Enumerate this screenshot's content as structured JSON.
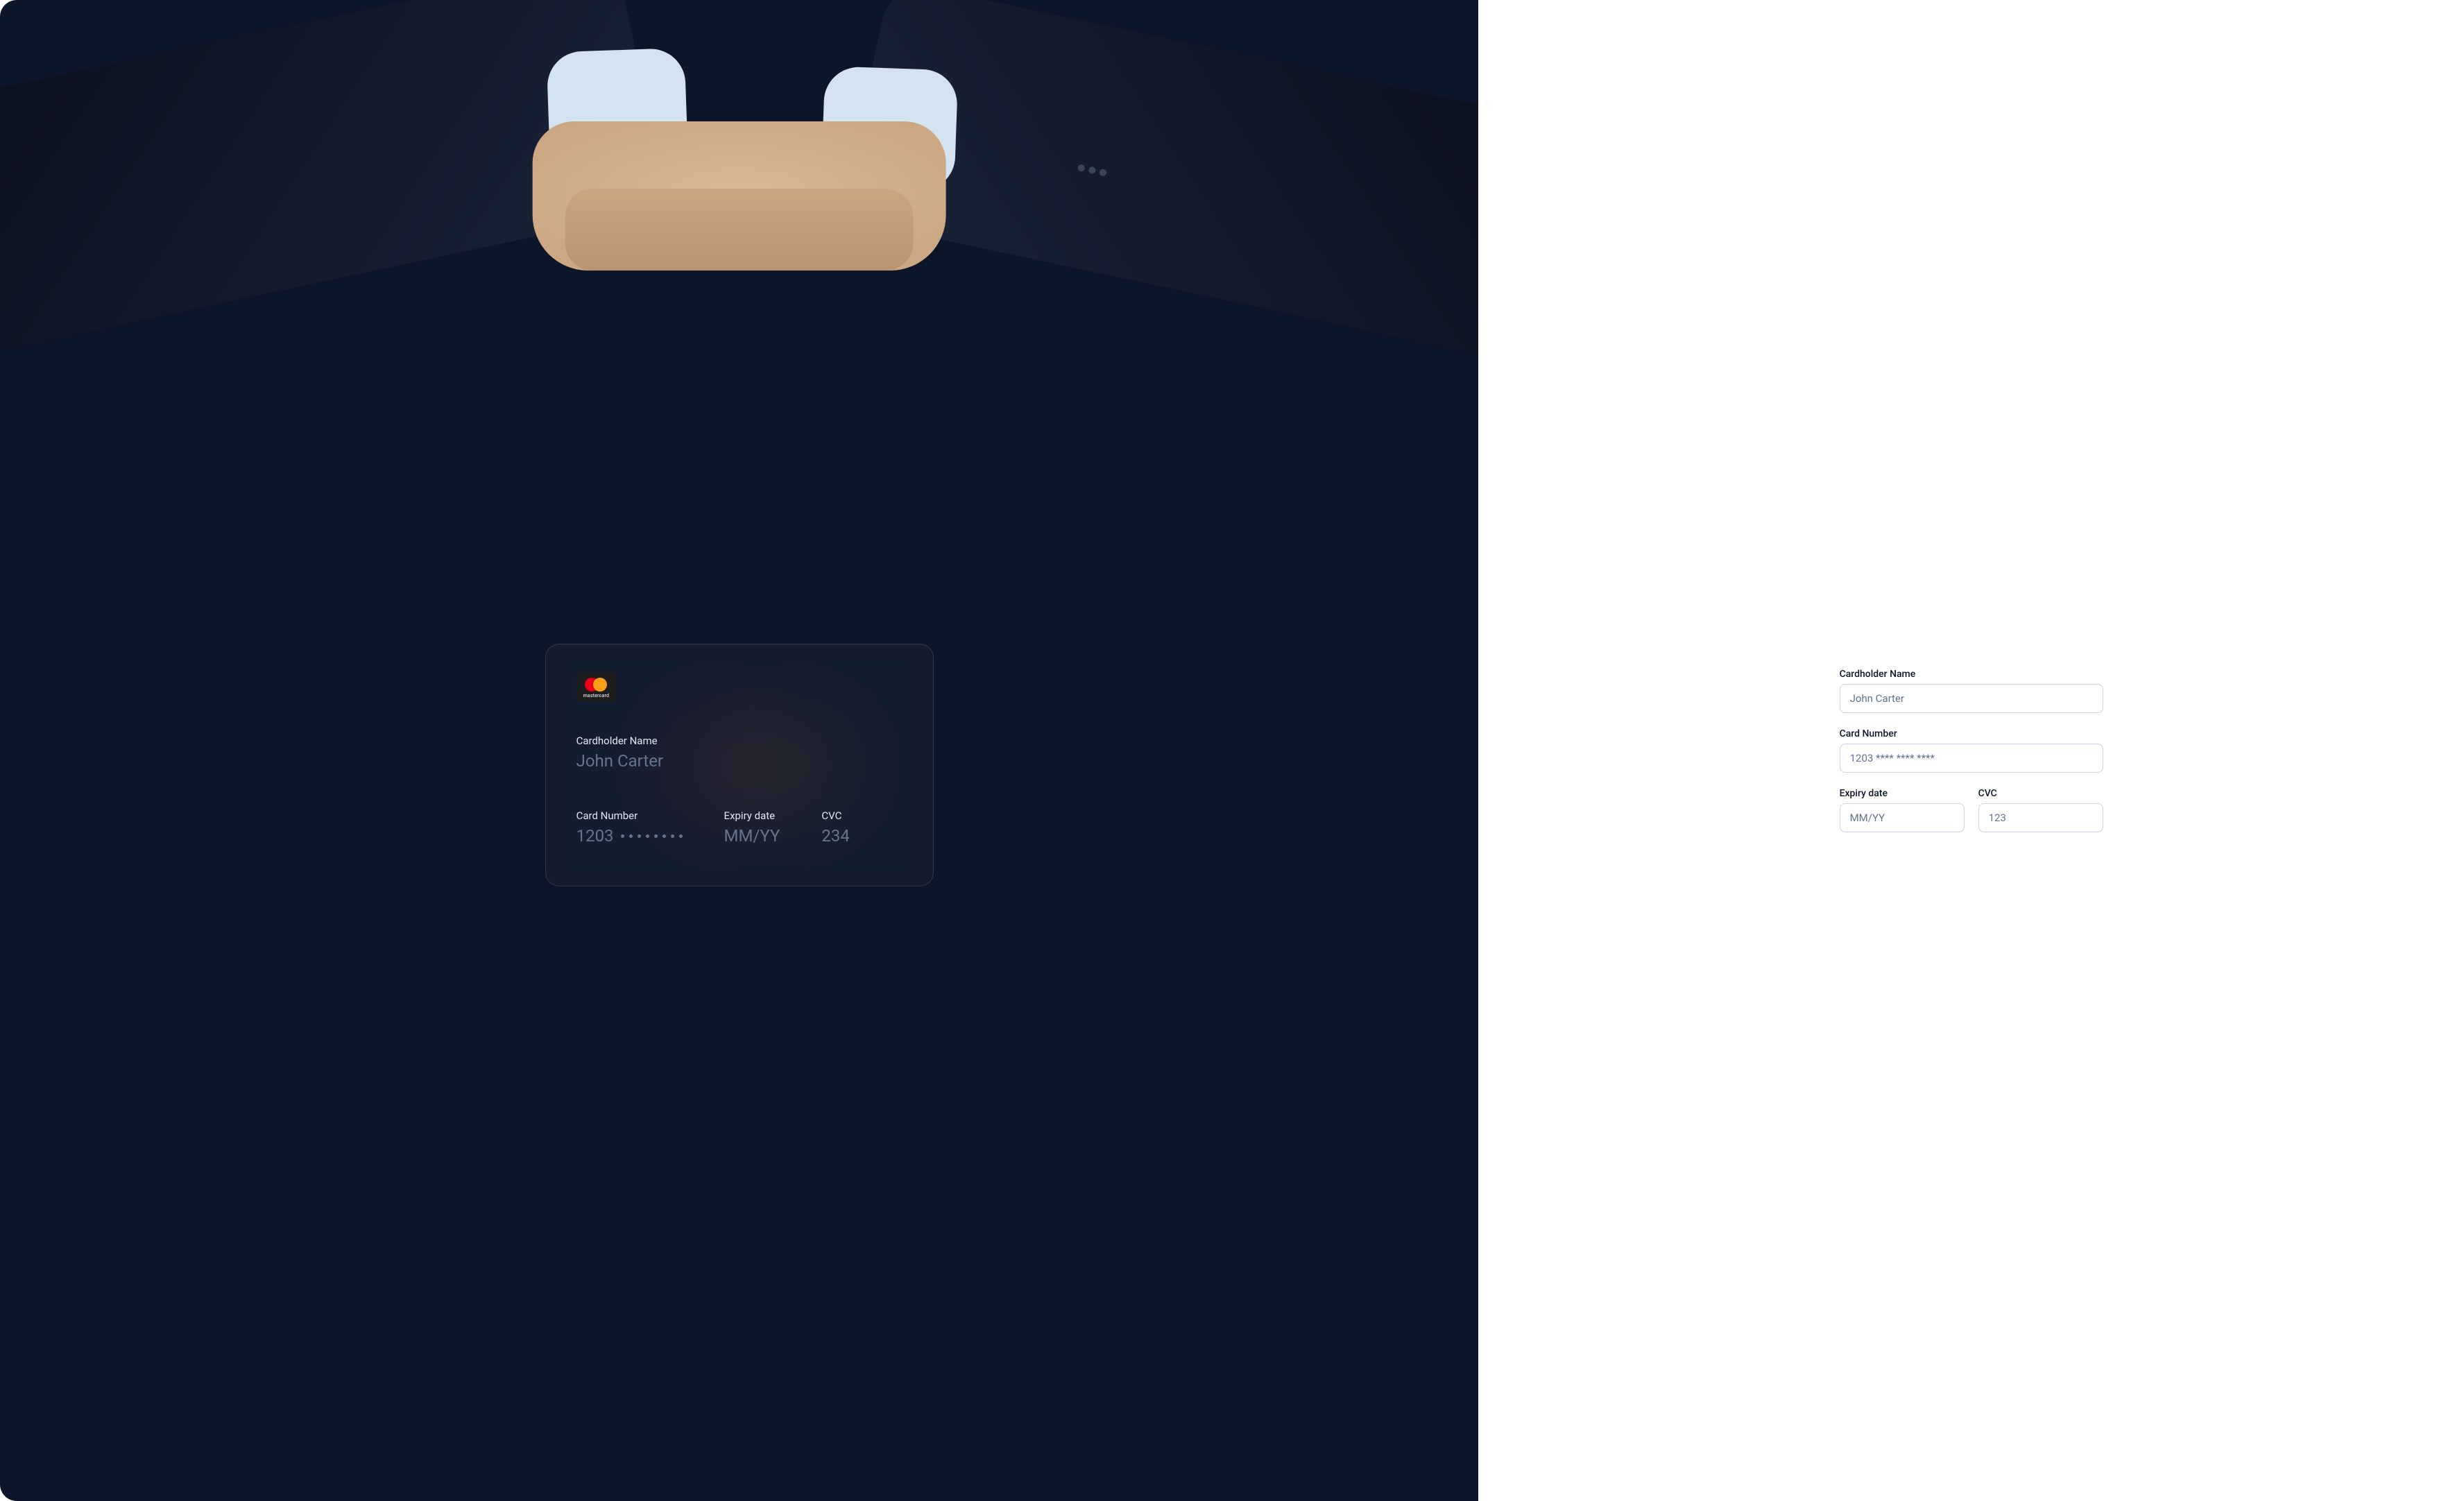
{
  "card": {
    "brand_text": "mastercard",
    "name_label": "Cardholder Name",
    "name_value": "John Carter",
    "number_label": "Card Number",
    "number_prefix": "1203",
    "expiry_label": "Expiry date",
    "expiry_value": "MM/YY",
    "cvc_label": "CVC",
    "cvc_value": "234"
  },
  "form": {
    "name_label": "Cardholder Name",
    "name_placeholder": "John Carter",
    "name_value": "",
    "number_label": "Card Number",
    "number_placeholder": "1203 **** **** ****",
    "number_value": "",
    "expiry_label": "Expiry date",
    "expiry_placeholder": "MM/YY",
    "expiry_value": "",
    "cvc_label": "CVC",
    "cvc_placeholder": "123",
    "cvc_value": ""
  }
}
